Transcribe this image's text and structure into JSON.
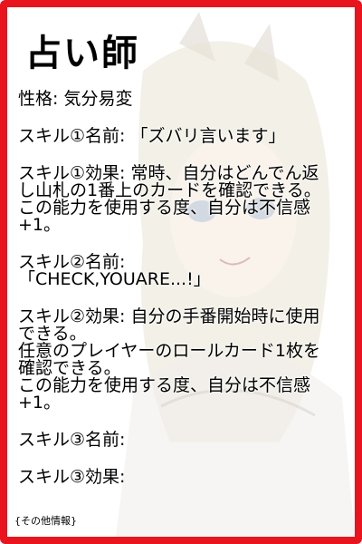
{
  "card": {
    "title": "占い師",
    "personality": "性格: 気分易変",
    "skill1_name": "スキル①名前: 「ズバリ言います」",
    "skill1_effect_lines": [
      "スキル①効果: 常時、自分はどんでん返",
      "し山札の1番上のカードを確認できる。",
      "この能力を使用する度、自分は不信感",
      "+1。"
    ],
    "skill2_name_lines": [
      "スキル②名前:",
      "「CHECK,YOUARE...!」"
    ],
    "skill2_effect_lines": [
      "スキル②効果: 自分の手番開始時に使用",
      "できる。",
      "任意のプレイヤーのロールカード1枚を",
      "確認できる。",
      "この能力を使用する度、自分は不信感",
      "+1。"
    ],
    "skill3_name": "スキル③名前:",
    "skill3_effect": "スキル③効果:",
    "footer": "{その他情報}"
  },
  "colors": {
    "border": "#e8141e",
    "text": "#000000",
    "background": "#ffffff"
  }
}
